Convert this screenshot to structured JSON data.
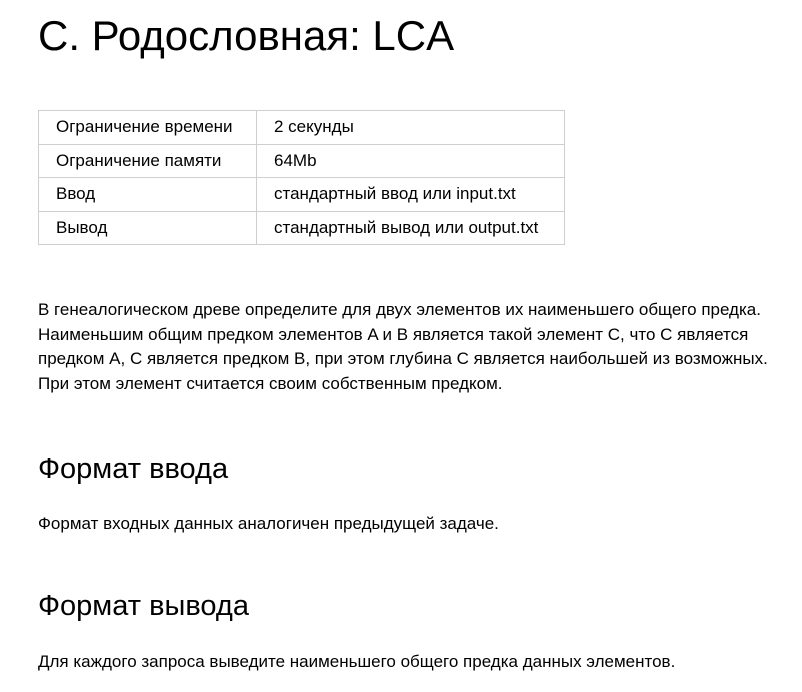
{
  "problem": {
    "title": "C. Родословная: LCA"
  },
  "limits": [
    {
      "key": "Ограничение времени",
      "value": "2 секунды"
    },
    {
      "key": "Ограничение памяти",
      "value": "64Mb"
    },
    {
      "key": "Ввод",
      "value": "стандартный ввод или input.txt"
    },
    {
      "key": "Вывод",
      "value": "стандартный вывод или output.txt"
    }
  ],
  "legend": {
    "lines": [
      "В генеалогическом древе определите для двух элементов их наименьшего общего предка.",
      "Наименьшим общим предком элементов A и B является такой элемент C, что С является",
      "предком A, C является предком B, при этом глубина C является наибольшей из возможных.",
      "При этом элемент считается своим собственным предком."
    ]
  },
  "input_format": {
    "heading": "Формат ввода",
    "text": "Формат входных данных аналогичен предыдущей задаче."
  },
  "output_format": {
    "heading": "Формат вывода",
    "text": "Для каждого запроса выведите наименьшего общего предка данных элементов."
  }
}
